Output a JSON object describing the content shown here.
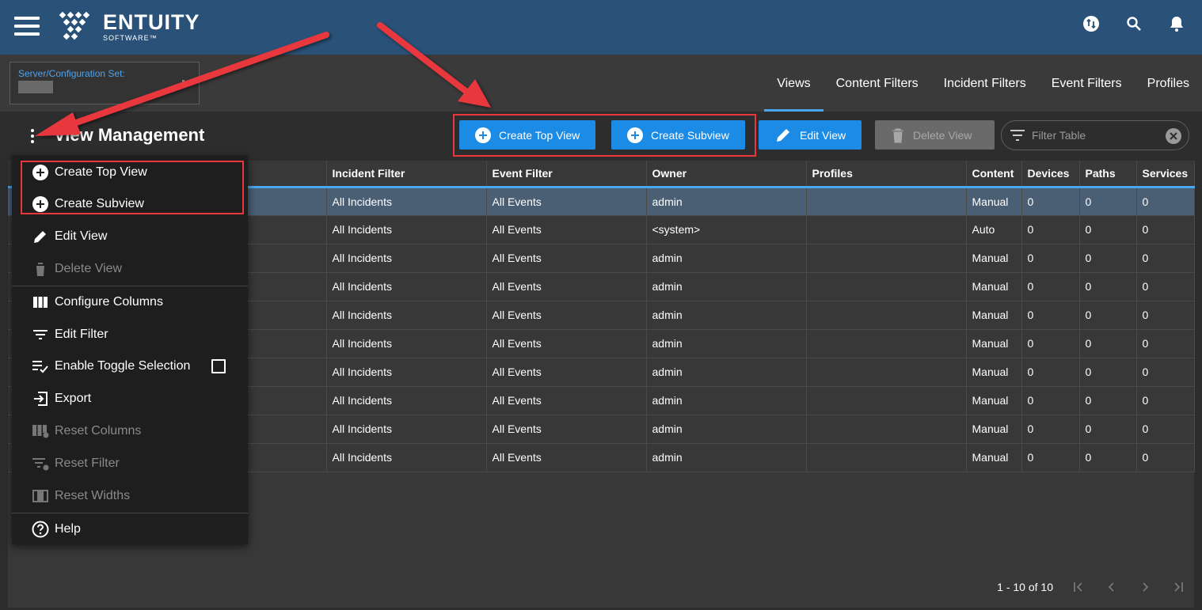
{
  "app": {
    "logo_name": "ENTUITY",
    "logo_sub": "SOFTWARE™"
  },
  "server": {
    "label": "Server/Configuration Set:"
  },
  "nav": {
    "tabs": [
      {
        "label": "Views",
        "active": true
      },
      {
        "label": "Content Filters"
      },
      {
        "label": "Incident Filters"
      },
      {
        "label": "Event Filters"
      },
      {
        "label": "Profiles"
      }
    ]
  },
  "toolbar": {
    "title": "View Management",
    "create_top_view": "Create Top View",
    "create_subview": "Create Subview",
    "edit_view": "Edit View",
    "delete_view": "Delete View",
    "filter_placeholder": "Filter Table"
  },
  "menu": {
    "create_top_view": "Create Top View",
    "create_subview": "Create Subview",
    "edit_view": "Edit View",
    "delete_view": "Delete View",
    "configure_columns": "Configure Columns",
    "edit_filter": "Edit Filter",
    "enable_toggle_selection": "Enable Toggle Selection",
    "export": "Export",
    "reset_columns": "Reset Columns",
    "reset_filter": "Reset Filter",
    "reset_widths": "Reset Widths",
    "help": "Help"
  },
  "table": {
    "columns": [
      "Incident Filter",
      "Event Filter",
      "Owner",
      "Profiles",
      "Content",
      "Devices",
      "Paths",
      "Services"
    ],
    "rows": [
      [
        "All Incidents",
        "All Events",
        "admin",
        "",
        "Manual",
        "0",
        "0",
        "0"
      ],
      [
        "All Incidents",
        "All Events",
        "<system>",
        "",
        "Auto",
        "0",
        "0",
        "0"
      ],
      [
        "All Incidents",
        "All Events",
        "admin",
        "",
        "Manual",
        "0",
        "0",
        "0"
      ],
      [
        "All Incidents",
        "All Events",
        "admin",
        "",
        "Manual",
        "0",
        "0",
        "0"
      ],
      [
        "All Incidents",
        "All Events",
        "admin",
        "",
        "Manual",
        "0",
        "0",
        "0"
      ],
      [
        "All Incidents",
        "All Events",
        "admin",
        "",
        "Manual",
        "0",
        "0",
        "0"
      ],
      [
        "All Incidents",
        "All Events",
        "admin",
        "",
        "Manual",
        "0",
        "0",
        "0"
      ],
      [
        "All Incidents",
        "All Events",
        "admin",
        "",
        "Manual",
        "0",
        "0",
        "0"
      ],
      [
        "All Incidents",
        "All Events",
        "admin",
        "",
        "Manual",
        "0",
        "0",
        "0"
      ],
      [
        "All Incidents",
        "All Events",
        "admin",
        "",
        "Manual",
        "0",
        "0",
        "0"
      ]
    ]
  },
  "pager": {
    "range": "1 - 10 of 10"
  },
  "colors": {
    "header_bg": "#2a5178",
    "accent_blue": "#1c8be6",
    "highlight_red": "#e8383d"
  }
}
